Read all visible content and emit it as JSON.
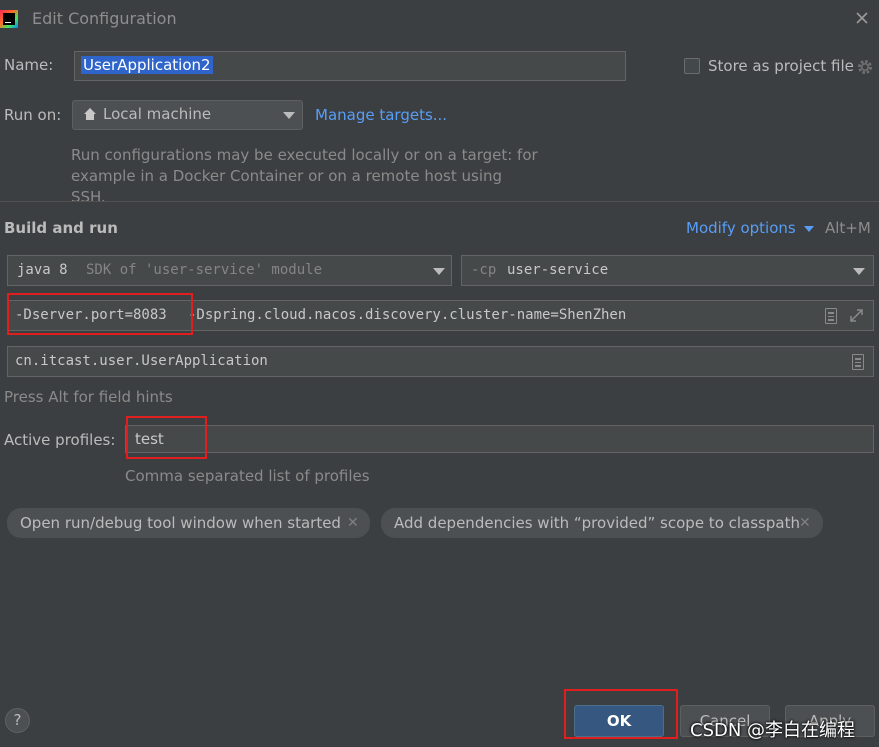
{
  "window": {
    "title": "Edit Configuration",
    "app_icon": "intellij-icon",
    "close_icon": "close-icon"
  },
  "name": {
    "label": "Name:",
    "value": "UserApplication2"
  },
  "store": {
    "label": "Store as project file",
    "icon": "gear-icon",
    "checked": false
  },
  "run_on": {
    "label": "Run on:",
    "selected": "Local machine",
    "icon": "home-icon",
    "manage_link": "Manage targets...",
    "hint": "Run configurations may be executed locally or on a target: for example in a Docker Container or on a remote host using SSH."
  },
  "build_and_run": {
    "heading": "Build and run",
    "modify_options": "Modify options",
    "shortcut": "Alt+M",
    "sdk": {
      "bold": "java 8",
      "rest": "SDK of 'user-service' module"
    },
    "classpath": {
      "prefix": "-cp",
      "value": "user-service"
    },
    "vm_options": {
      "highlighted": "-Dserver.port=8083",
      "rest": "-Dspring.cloud.nacos.discovery.cluster-name=ShenZhen"
    },
    "main_class": "cn.itcast.user.UserApplication",
    "field_hint": "Press Alt for field hints"
  },
  "profiles": {
    "label": "Active profiles:",
    "value": "test",
    "hint": "Comma separated list of profiles"
  },
  "chips": [
    {
      "label": "Open run/debug tool window when started"
    },
    {
      "label": "Add dependencies with “provided” scope to classpath"
    }
  ],
  "footer": {
    "help": "?",
    "ok": "OK",
    "cancel": "Cancel",
    "apply": "Apply"
  },
  "watermark": "CSDN @李白在编程",
  "colors": {
    "background": "#3c3f41",
    "accent": "#365880",
    "link": "#589df6",
    "highlight": "#e01e1e"
  }
}
